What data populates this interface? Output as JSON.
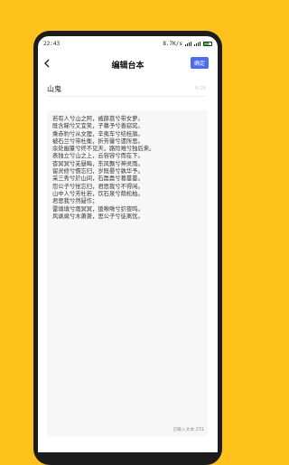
{
  "status_bar": {
    "time": "22:43",
    "network": "8.7K/s"
  },
  "header": {
    "title": "编辑台本",
    "confirm_label": "确定"
  },
  "title_field": {
    "value": "山鬼",
    "counter": "0/20"
  },
  "content": {
    "lines": [
      "若有人兮山之阿，被薜荔兮带女萝。",
      "既含睇兮又宜笑，子慕予兮善窈窕。",
      "乘赤豹兮从文狸，辛夷车兮结桂旗。",
      "被石兰兮带杜衡，折芳馨兮遗所思。",
      "余处幽篁兮终不见天，路险难兮独后来。",
      "表独立兮山之上，云容容兮而在下。",
      "杳冥冥兮羌昼晦，东风飘兮神灵雨。",
      "留灵修兮憺忘归，岁既晏兮孰华予。",
      "采三秀兮於山间，石磊磊兮葛蔓蔓。",
      "怨公子兮怅忘归，君思我兮不得闲。",
      "山中人兮芳杜若，饮石泉兮荫松柏。",
      "君思我兮然疑作；",
      "雷填填兮雨冥冥，猨啾啾兮狖夜鸣。",
      "风飒飒兮木萧萧，思公子兮徒离忧。"
    ],
    "char_count_label": "已输入文本:231"
  }
}
